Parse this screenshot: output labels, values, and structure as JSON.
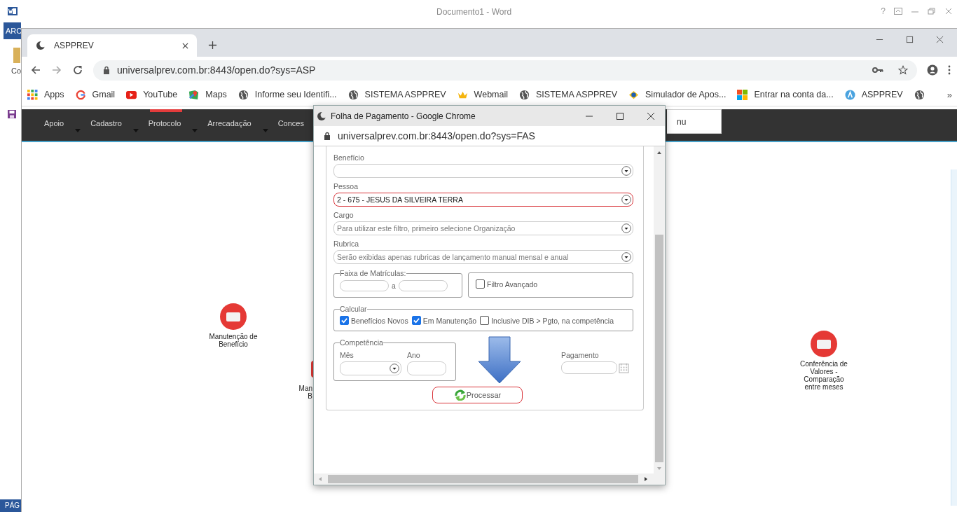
{
  "word": {
    "title": "Documento1 - Word",
    "help": "?",
    "ribbon_tab": "ARC",
    "left_text": "Co",
    "status": "PÁG"
  },
  "chrome": {
    "tab": "ASPPREV",
    "url": "universalprev.com.br:8443/open.do?sys=ASP",
    "overflow": "»",
    "bookmarks": [
      {
        "label": "Apps",
        "kind": "apps"
      },
      {
        "label": "Gmail",
        "kind": "google"
      },
      {
        "label": "YouTube",
        "kind": "youtube"
      },
      {
        "label": "Maps",
        "kind": "maps"
      },
      {
        "label": "Informe seu Identifi...",
        "kind": "globe"
      },
      {
        "label": "SISTEMA ASPPREV",
        "kind": "globe"
      },
      {
        "label": "Webmail",
        "kind": "crown"
      },
      {
        "label": "SISTEMA ASPPREV",
        "kind": "globe"
      },
      {
        "label": "Simulador de Apos...",
        "kind": "sim"
      },
      {
        "label": "Entrar na conta da...",
        "kind": "ms"
      },
      {
        "label": "ASPPREV",
        "kind": "asp"
      },
      {
        "kind": "globe"
      }
    ]
  },
  "page": {
    "nav": [
      {
        "label": "Apoio",
        "selected": false
      },
      {
        "label": "Cadastro",
        "selected": false
      },
      {
        "label": "Protocolo",
        "selected": true
      },
      {
        "label": "Arrecadação",
        "selected": false
      },
      {
        "label": "Conces",
        "selected": false
      }
    ],
    "menu_tail": "nu",
    "nodes": [
      {
        "lines": [
          "Manutenção de",
          "Benefício"
        ]
      },
      {
        "lines": [
          "Man",
          "B"
        ]
      },
      {
        "lines": [
          "Conferência de",
          "Valores -",
          "Comparação",
          "entre meses"
        ]
      }
    ]
  },
  "popup": {
    "title": "Folha de Pagamento - Google Chrome",
    "url": "universalprev.com.br:8443/open.do?sys=FAS",
    "selects": [
      {
        "label": "Benefício",
        "focused": false
      },
      {
        "label": "Pessoa",
        "value": "2 - 675 - JESUS DA SILVEIRA TERRA",
        "focused": true
      },
      {
        "label": "Cargo",
        "placeholder": "Para utilizar este filtro, primeiro selecione Organização",
        "focused": false
      },
      {
        "label": "Rubrica",
        "placeholder": "Serão exibidas apenas rubricas de lançamento manual mensal e anual",
        "focused": false
      }
    ],
    "faixa": {
      "legend": "Faixa de Matrículas:",
      "separator": "a"
    },
    "filtro": {
      "label": "Filtro Avançado",
      "checked": false
    },
    "calcular": {
      "legend": "Calcular",
      "options": [
        {
          "label": "Benefícios Novos",
          "checked": true
        },
        {
          "label": "Em Manutenção",
          "checked": true
        },
        {
          "label": "Inclusive DIB > Pgto, na competência",
          "checked": false
        }
      ]
    },
    "competencia": {
      "legend": "Competência",
      "month_label": "Mês",
      "year_label": "Ano"
    },
    "pagamento": {
      "label": "Pagamento"
    },
    "button": "Processar"
  }
}
